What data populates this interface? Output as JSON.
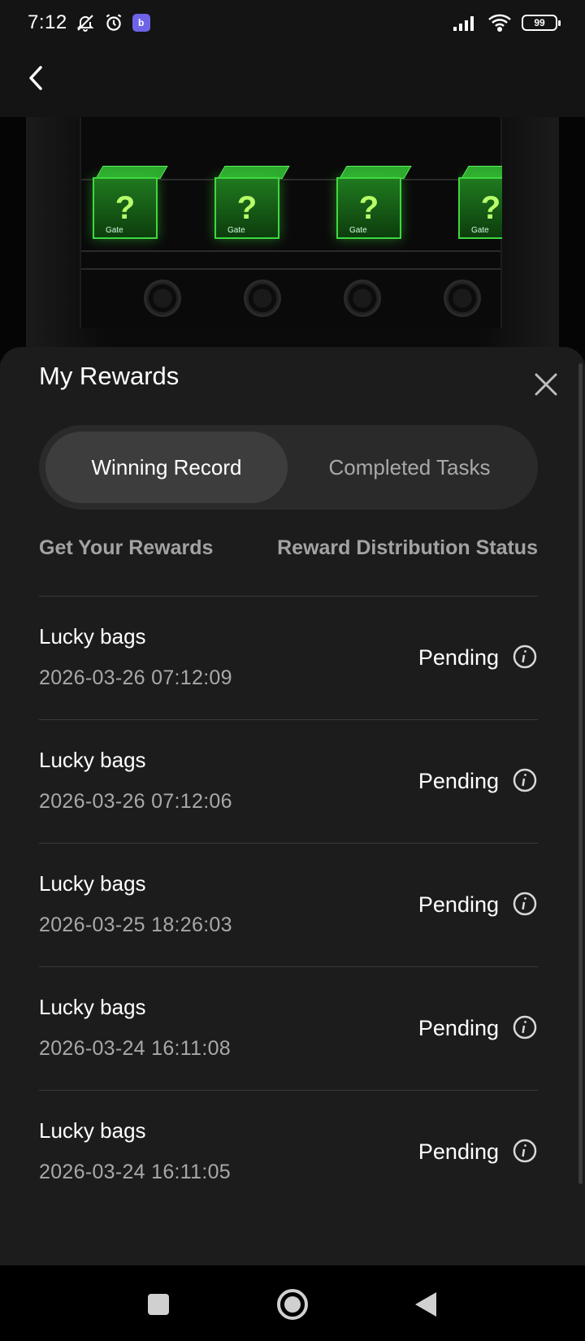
{
  "status_bar": {
    "time": "7:12",
    "battery": "99",
    "app_badge": "b"
  },
  "banner": {
    "box_symbol": "?",
    "box_brand": "Gate"
  },
  "sheet": {
    "title": "My Rewards",
    "tabs": [
      {
        "label": "Winning Record",
        "active": true
      },
      {
        "label": "Completed Tasks",
        "active": false
      }
    ],
    "columns": {
      "left": "Get Your Rewards",
      "right": "Reward Distribution Status"
    },
    "records": [
      {
        "title": "Lucky bags",
        "date": "2026-03-26 07:12:09",
        "status": "Pending"
      },
      {
        "title": "Lucky bags",
        "date": "2026-03-26 07:12:06",
        "status": "Pending"
      },
      {
        "title": "Lucky bags",
        "date": "2026-03-25 18:26:03",
        "status": "Pending"
      },
      {
        "title": "Lucky bags",
        "date": "2026-03-24 16:11:08",
        "status": "Pending"
      },
      {
        "title": "Lucky bags",
        "date": "2026-03-24 16:11:05",
        "status": "Pending"
      }
    ]
  },
  "icons": {
    "back": "chevron-left-icon",
    "close": "close-icon",
    "info": "info-icon",
    "nav_recent": "square-icon",
    "nav_home": "circle-icon",
    "nav_back": "triangle-icon"
  },
  "colors": {
    "sheet_bg": "#1c1c1d",
    "tab_active_bg": "#3d3d3e",
    "box_green": "#3ed83e"
  }
}
